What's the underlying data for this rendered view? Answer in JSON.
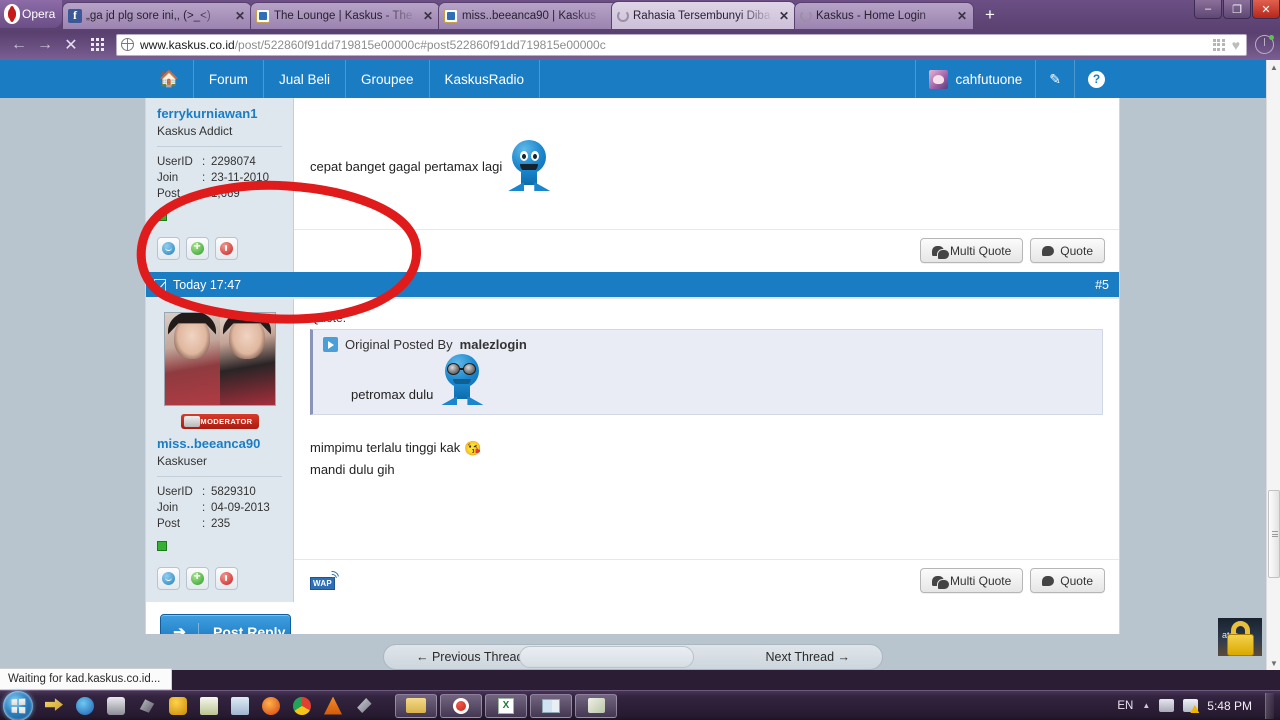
{
  "browser": {
    "menu_button": "Opera",
    "tabs": [
      {
        "title": "„ga jd plg sore ini,, (>_<)",
        "favicon": "facebook-icon",
        "active": false
      },
      {
        "title": "The Lounge | Kaskus - The",
        "favicon": "kaskus-icon",
        "active": false
      },
      {
        "title": "miss..beeanca90 | Kaskus",
        "favicon": "kaskus-icon",
        "active": false
      },
      {
        "title": "Rahasia Tersembunyi Diba",
        "favicon": "loading-spinner-icon",
        "active": true
      },
      {
        "title": "Kaskus - Home Login",
        "favicon": "loading-spinner-icon",
        "active": false
      }
    ],
    "new_tab_label": "+",
    "window_controls": {
      "minimize": "–",
      "restore": "❐",
      "close": "✕"
    },
    "toolbar": {
      "back": "←",
      "forward": "→",
      "stop": "✕"
    },
    "url": {
      "host": "www.kaskus.co.id",
      "path": "/post/522860f91dd719815e00000c#post522860f91dd719815e00000c"
    },
    "status_text": "Waiting for kad.kaskus.co.id..."
  },
  "site": {
    "nav": [
      {
        "label": "",
        "icon": "home-icon"
      },
      {
        "label": "Forum"
      },
      {
        "label": "Jual Beli"
      },
      {
        "label": "Groupee"
      },
      {
        "label": "KaskusRadio"
      }
    ],
    "account": {
      "username": "cahfutuone",
      "edit_icon": "pencil-icon",
      "help_icon": "help-icon"
    },
    "accent_color": "#1a7dc4"
  },
  "posts": [
    {
      "user": {
        "name": "ferrykurniawan1",
        "title": "Kaskus Addict",
        "fields": [
          {
            "key": "UserID",
            "sep": ":",
            "value": "2298074"
          },
          {
            "key": "Join",
            "sep": ":",
            "value": "23-11-2010"
          },
          {
            "key": "Post",
            "sep": ":",
            "value": "1,669"
          }
        ],
        "status": "online",
        "badges": [
          "smiley-icon",
          "plus-reputation-icon",
          "minus-reputation-icon"
        ]
      },
      "message": "cepat banget gagal pertamax lagi",
      "emoticon": "blue-smiley-shocked-icon",
      "footer": {
        "multi_quote": "Multi Quote",
        "quote": "Quote"
      }
    },
    {
      "header": {
        "timestamp": "Today 17:47",
        "number": "#5",
        "checkbox": "checked-icon"
      },
      "user": {
        "name": "miss..beeanca90",
        "title": "Kaskuser",
        "badge_label": "MODERATOR",
        "avatar": "user-photo-avatar",
        "fields": [
          {
            "key": "UserID",
            "sep": ":",
            "value": "5829310"
          },
          {
            "key": "Join",
            "sep": ":",
            "value": "04-09-2013"
          },
          {
            "key": "Post",
            "sep": ":",
            "value": "235"
          }
        ],
        "status": "online",
        "badges": [
          "smiley-icon",
          "plus-reputation-icon",
          "minus-reputation-icon"
        ]
      },
      "quote": {
        "label": "Quote:",
        "attribution_prefix": "Original Posted By",
        "attribution_user": "malezlogin",
        "text": "petromax dulu",
        "emoticon": "blue-smiley-sunglasses-icon"
      },
      "message_lines": [
        "mimpimu terlalu tinggi kak",
        "mandi dulu gih"
      ],
      "message_emoticon": "yellow-kiss-emoji",
      "annotation": {
        "type": "red-circle-highlight",
        "color": "#e01b1b"
      },
      "wap_icon": "wap-icon",
      "footer": {
        "multi_quote": "Multi Quote",
        "quote": "Quote"
      }
    }
  ],
  "reply": {
    "label": "Post Reply",
    "icon": "reply-arrow-icon"
  },
  "thread_nav": {
    "previous": "← Previous Thread",
    "next": "Next Thread →"
  },
  "taskbar": {
    "start": "start-orb",
    "quick_launch": [
      "show-desktop-icon",
      "opera-turbo-icon",
      "camera-icon",
      "emule-icon",
      "utorrent-icon",
      "notepad-icon",
      "jc-app-icon",
      "firefox-icon",
      "chrome-icon",
      "vlc-icon",
      "shortcut-icon"
    ],
    "tasks": [
      "explorer-window",
      "opera-window",
      "excel-window",
      "media-window",
      "paint-window"
    ],
    "tray": {
      "language": "EN",
      "caret": "▲",
      "icons": [
        "network-icon",
        "action-center-warning-icon"
      ],
      "clock": "5:48 PM"
    }
  }
}
